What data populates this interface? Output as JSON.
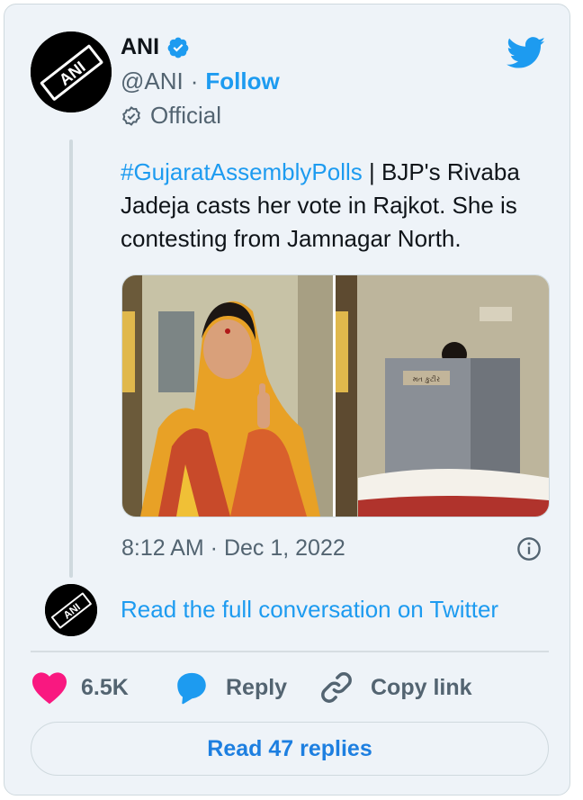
{
  "author": {
    "name": "ANI",
    "handle": "@ANI",
    "separator": "·",
    "follow_label": "Follow",
    "label": "Official",
    "logo_text": "ANI"
  },
  "tweet": {
    "hashtag": "#GujaratAssemblyPolls",
    "text": " | BJP's Rivaba Jadeja casts her vote in Rajkot. She is contesting from Jamnagar North.",
    "timestamp": "8:12 AM · Dec 1, 2022"
  },
  "media": {
    "photo_left_icon": "woman-showing-inked-finger-photo",
    "photo_right_icon": "voting-booth-photo",
    "booth_sign": "મત કુટીર"
  },
  "conversation": {
    "read_full_label": "Read the full conversation on Twitter"
  },
  "actions": {
    "like_count": "6.5K",
    "reply_label": "Reply",
    "copy_link_label": "Copy link"
  },
  "footer": {
    "read_replies_label": "Read 47 replies"
  },
  "colors": {
    "accent": "#1d9bf0",
    "like": "#f91880",
    "card_bg": "#eef3f8"
  }
}
